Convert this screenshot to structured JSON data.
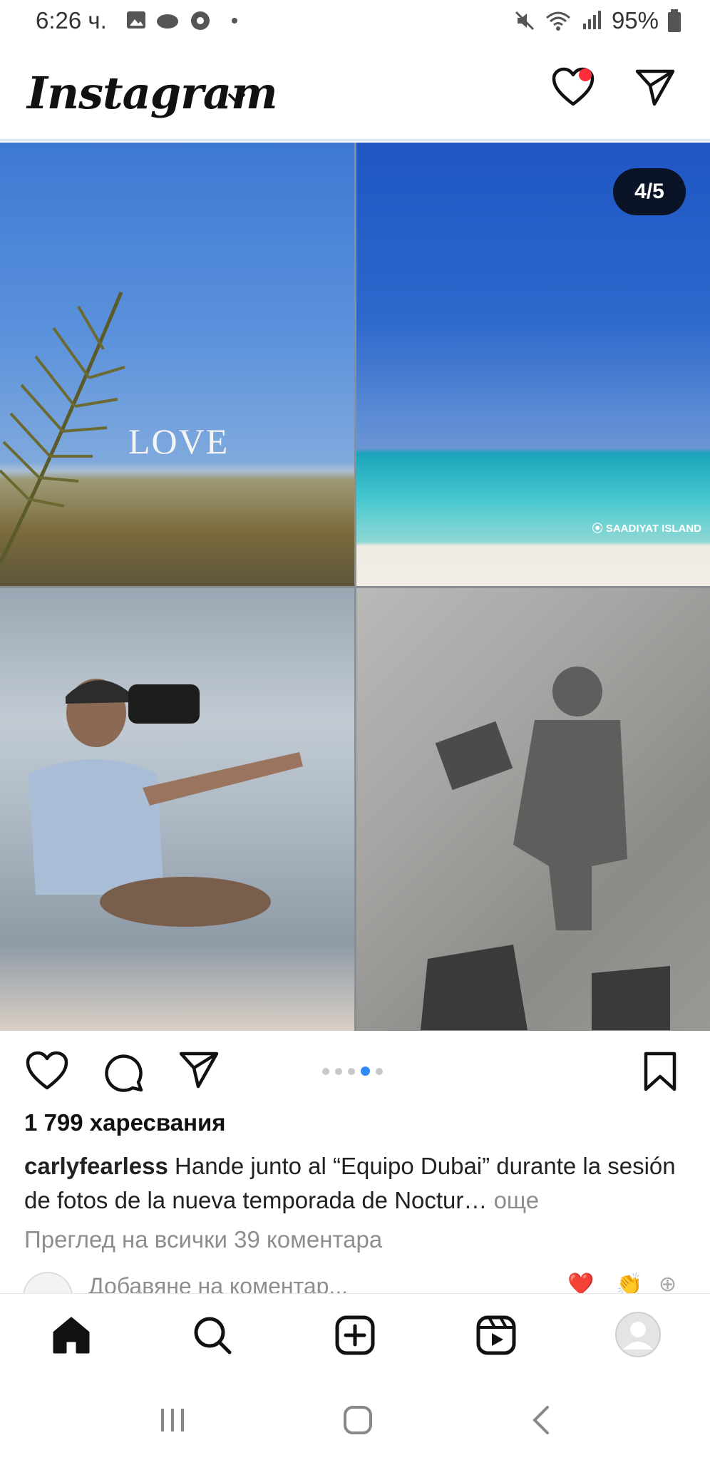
{
  "status_bar": {
    "time": "6:26 ч.",
    "battery": "95%"
  },
  "header": {
    "logo": "Instagram",
    "notification_dot_color": "#ff2d3a"
  },
  "post": {
    "image_text_love": "LOVE",
    "image_location_tag": "SAADIYAT ISLAND",
    "carousel_counter": "4/5",
    "carousel_total": 5,
    "carousel_current": 4,
    "likes": "1 799 харесвания",
    "username": "carlyfearless",
    "caption": " Hande junto al “Equipo Dubai” durante la sesión de fotos de la nueva temporada de Noctur… ",
    "more_label": "още",
    "view_comments": "Преглед на всички 39 коментара",
    "add_comment_placeholder": "Добавяне на коментар..."
  },
  "icons": {
    "activity": "heart-icon",
    "direct": "paper-plane-icon",
    "home": "home-icon",
    "search": "search-icon",
    "create": "plus-square-icon",
    "reels": "reels-icon",
    "profile": "avatar-icon"
  },
  "colors": {
    "accent_blue": "#2f8af5",
    "counter_bg": "#0b1326"
  }
}
